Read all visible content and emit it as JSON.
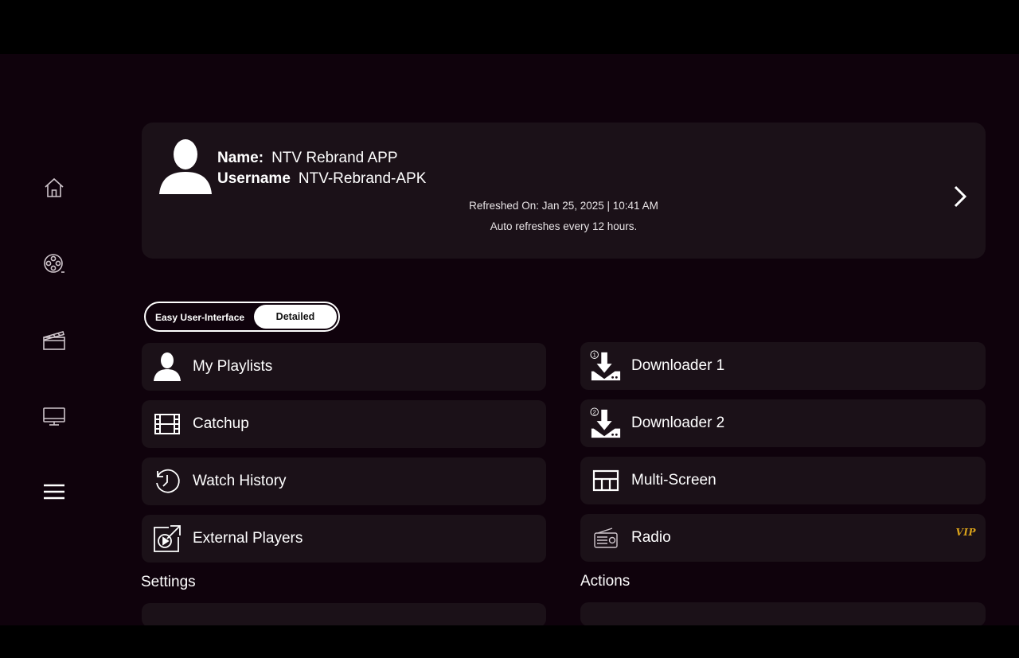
{
  "profile": {
    "name_label": "Name:",
    "name_value": "NTV Rebrand APP",
    "username_label": "Username",
    "username_value": "NTV-Rebrand-APK",
    "refreshed": "Refreshed On: Jan 25, 2025 | 10:41 AM",
    "auto_refresh": "Auto refreshes every 12 hours."
  },
  "sidebar": {
    "items": [
      {
        "icon": "home-icon"
      },
      {
        "icon": "film-reel-icon"
      },
      {
        "icon": "clapperboard-icon"
      },
      {
        "icon": "tv-icon"
      },
      {
        "icon": "hamburger-menu-icon"
      }
    ]
  },
  "toggle": {
    "easy_label": "Easy User-Interface",
    "detailed_label": "Detailed",
    "selected": "Detailed"
  },
  "menu": {
    "left": [
      {
        "label": "My Playlists",
        "icon": "user-icon"
      },
      {
        "label": "Catchup",
        "icon": "film-strip-icon"
      },
      {
        "label": "Watch History",
        "icon": "history-clock-icon"
      },
      {
        "label": "External Players",
        "icon": "external-player-icon"
      }
    ],
    "right": [
      {
        "label": "Downloader 1",
        "icon": "download-icon",
        "badge": "1"
      },
      {
        "label": "Downloader 2",
        "icon": "download-icon",
        "badge": "2"
      },
      {
        "label": "Multi-Screen",
        "icon": "multiscreen-icon"
      },
      {
        "label": "Radio",
        "icon": "radio-icon",
        "tag": "VIP"
      }
    ]
  },
  "sections": {
    "settings": "Settings",
    "actions": "Actions"
  },
  "colors": {
    "background": "#0f020c",
    "card": "#1b1118",
    "vip_gold": "#d9a21a"
  }
}
